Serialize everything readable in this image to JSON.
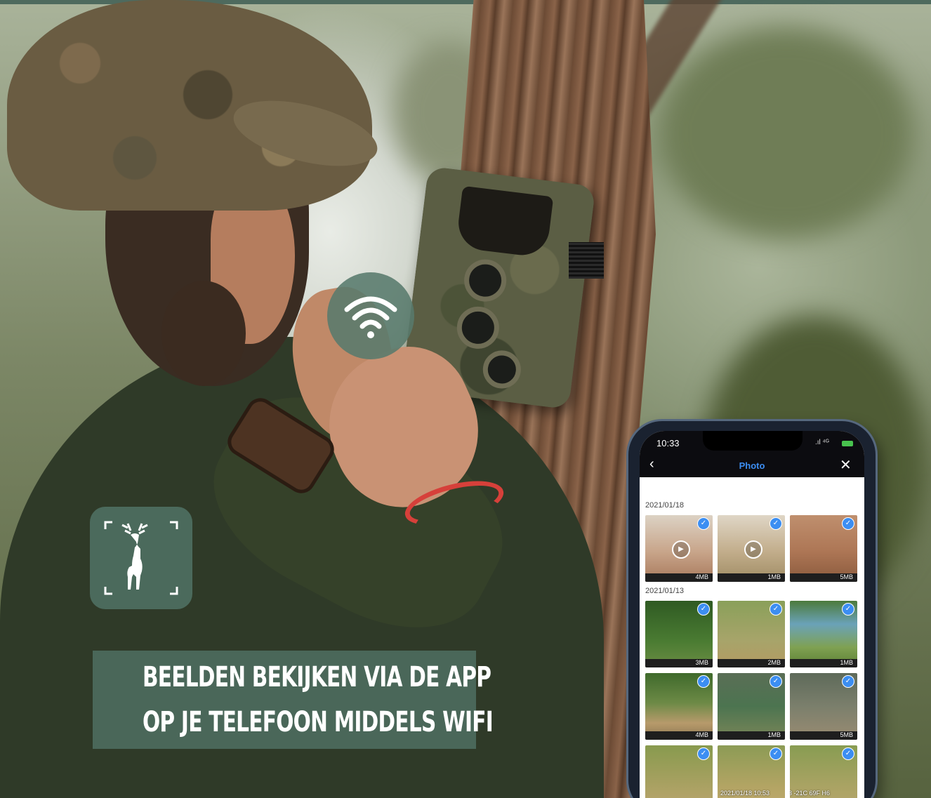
{
  "banner": {
    "line1": "BEELDEN BEKIJKEN VIA DE APP",
    "line2": "OP JE TELEFOON MIDDELS WIFI"
  },
  "badges": {
    "wifi_icon": "wifi-icon",
    "deer_icon": "deer-icon",
    "badge_color": "#4b6a5c"
  },
  "phone": {
    "status_time": "10:33",
    "status_signal": ".ıl ⁴ᴳ",
    "nav_title": "Photo",
    "back_icon": "chevron-left-icon",
    "close_icon": "close-icon",
    "accent": "#3c8ef2",
    "groups": [
      {
        "date": "2021/01/18",
        "items": [
          {
            "size": "4MB",
            "video": true
          },
          {
            "size": "1MB",
            "video": true
          },
          {
            "size": "5MB",
            "video": false
          }
        ]
      },
      {
        "date": "2021/01/13",
        "items": [
          {
            "size": "3MB"
          },
          {
            "size": "2MB"
          },
          {
            "size": "1MB"
          },
          {
            "size": "4MB"
          },
          {
            "size": "1MB"
          },
          {
            "size": "5MB"
          }
        ]
      }
    ],
    "partial_row_stamp_1": "2021/01/18  10:53",
    "partial_row_stamp_2": "3  -21C 69F H6"
  }
}
